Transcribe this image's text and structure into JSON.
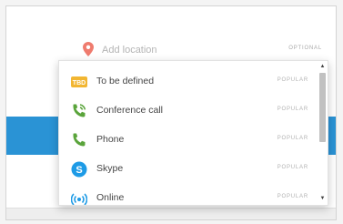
{
  "location": {
    "placeholder": "Add location",
    "optional_label": "OPTIONAL"
  },
  "dropdown": {
    "items": [
      {
        "label": "To be defined",
        "badge": "POPULAR",
        "icon": "tbd-icon",
        "icon_text": "TBD"
      },
      {
        "label": "Conference call",
        "badge": "POPULAR",
        "icon": "conference-call-icon"
      },
      {
        "label": "Phone",
        "badge": "POPULAR",
        "icon": "phone-icon"
      },
      {
        "label": "Skype",
        "badge": "POPULAR",
        "icon": "skype-icon",
        "icon_text": "S"
      },
      {
        "label": "Online",
        "badge": "POPULAR",
        "icon": "online-icon"
      }
    ]
  },
  "colors": {
    "accent_blue": "#2a93d5",
    "pin_red": "#ef7b6e",
    "phone_green": "#5aa43b",
    "tbd_yellow": "#f2b632",
    "skype_blue": "#1e9be6"
  }
}
